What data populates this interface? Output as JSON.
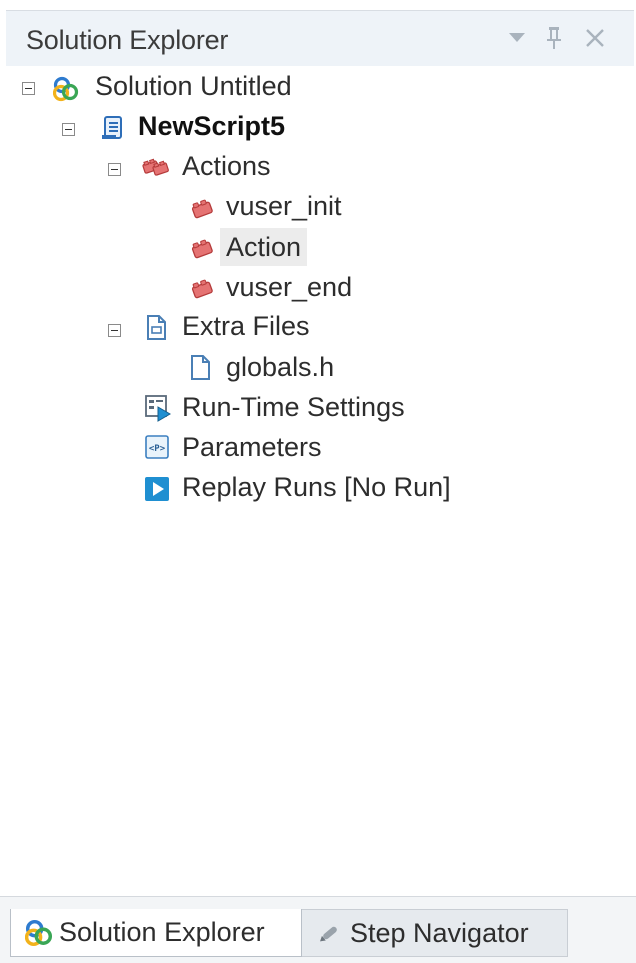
{
  "panel": {
    "title": "Solution Explorer"
  },
  "toolbar": {
    "dropdown_icon": "triangle-down-icon",
    "pin_icon": "pin-icon",
    "close_icon": "close-icon"
  },
  "tree": {
    "solution": {
      "label": "Solution Untitled",
      "icon": "solution-icon",
      "expanded": true
    },
    "script": {
      "label": "NewScript5",
      "icon": "script-icon",
      "expanded": true
    },
    "actions": {
      "label": "Actions",
      "icon": "actions-icon",
      "expanded": true
    },
    "action_items": [
      {
        "label": "vuser_init",
        "icon": "action-brick-icon"
      },
      {
        "label": "Action",
        "icon": "action-brick-icon",
        "selected": true
      },
      {
        "label": "vuser_end",
        "icon": "action-brick-icon"
      }
    ],
    "extra_files": {
      "label": "Extra Files",
      "icon": "extra-files-icon",
      "expanded": true
    },
    "globals": {
      "label": "globals.h",
      "icon": "file-icon"
    },
    "runtime_settings": {
      "label": "Run-Time Settings",
      "icon": "runtime-settings-icon"
    },
    "parameters": {
      "label": "Parameters",
      "icon": "parameters-icon"
    },
    "replay_runs": {
      "label": "Replay Runs [No Run]",
      "icon": "play-icon"
    }
  },
  "tabs": [
    {
      "label": "Solution Explorer",
      "icon": "solution-icon",
      "active": true
    },
    {
      "label": "Step Navigator",
      "icon": "pencil-icon",
      "active": false
    }
  ],
  "colors": {
    "header_bg": "#eef3f8",
    "selection_bg": "#ececec",
    "action_red": "#d9534f",
    "play_blue": "#1f8fd1"
  }
}
